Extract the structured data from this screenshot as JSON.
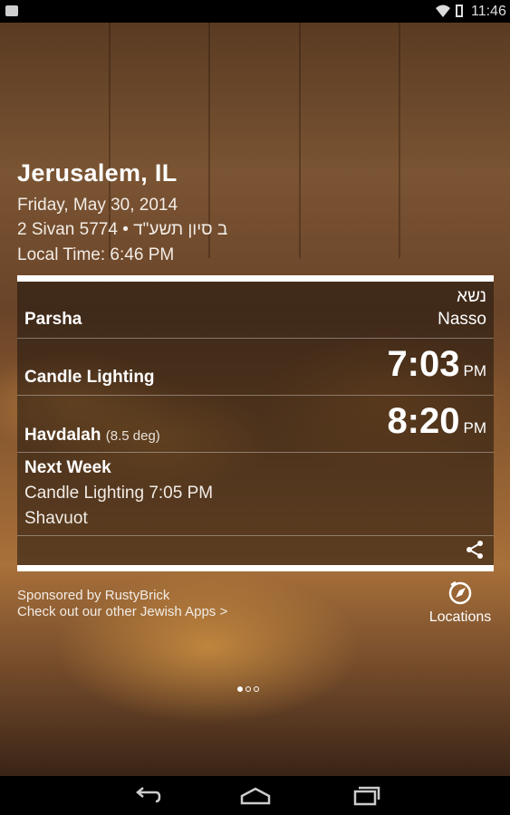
{
  "status_bar": {
    "time": "11:46"
  },
  "location": {
    "city": "Jerusalem, IL",
    "gregorian_date": "Friday, May 30, 2014",
    "hebrew_date_english": "2 Sivan 5774 •",
    "hebrew_date_hebrew": "ב סיון תשע\"ד",
    "local_time": "Local Time: 6:46 PM"
  },
  "times": {
    "parsha": {
      "label": "Parsha",
      "hebrew": "נשא",
      "english": "Nasso"
    },
    "candle_lighting": {
      "label": "Candle Lighting",
      "time": "7:03",
      "ampm": "PM"
    },
    "havdalah": {
      "label": "Havdalah",
      "sub": "(8.5 deg)",
      "time": "8:20",
      "ampm": "PM"
    },
    "next_week": {
      "title": "Next Week",
      "candle": "Candle Lighting 7:05 PM",
      "holiday": "Shavuot"
    }
  },
  "footer": {
    "sponsor": "Sponsored by RustyBrick",
    "other_apps": "Check out our other Jewish Apps >",
    "locations_label": "Locations"
  },
  "pager": {
    "total": 3,
    "active": 0
  },
  "icons": {
    "share": "share-icon",
    "locations": "compass-icon",
    "back": "back-icon",
    "home": "home-icon",
    "recents": "recents-icon"
  }
}
